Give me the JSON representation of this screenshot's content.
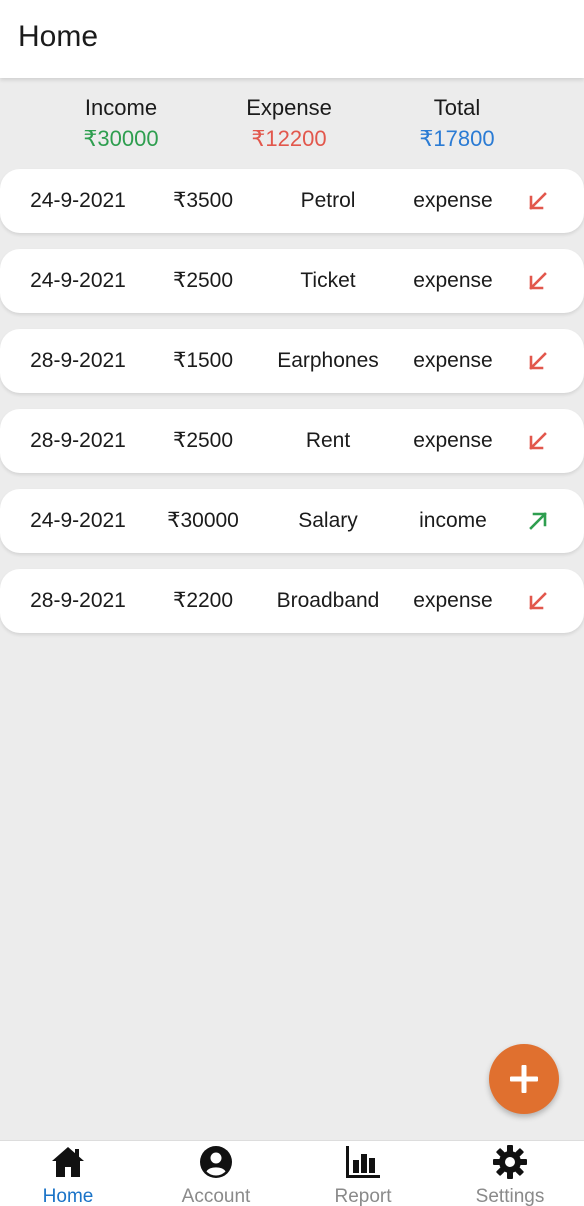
{
  "app_bar": {
    "title": "Home"
  },
  "summary": {
    "income": {
      "label": "Income",
      "value": "₹30000"
    },
    "expense": {
      "label": "Expense",
      "value": "₹12200"
    },
    "total": {
      "label": "Total",
      "value": "₹17800"
    }
  },
  "transactions": [
    {
      "date": "24-9-2021",
      "amount": "₹3500",
      "title": "Petrol",
      "type": "expense",
      "icon": "arrow-down-left-icon"
    },
    {
      "date": "24-9-2021",
      "amount": "₹2500",
      "title": "Ticket",
      "type": "expense",
      "icon": "arrow-down-left-icon"
    },
    {
      "date": "28-9-2021",
      "amount": "₹1500",
      "title": "Earphones",
      "type": "expense",
      "icon": "arrow-down-left-icon"
    },
    {
      "date": "28-9-2021",
      "amount": "₹2500",
      "title": "Rent",
      "type": "expense",
      "icon": "arrow-down-left-icon"
    },
    {
      "date": "24-9-2021",
      "amount": "₹30000",
      "title": "Salary",
      "type": "income",
      "icon": "arrow-up-right-icon"
    },
    {
      "date": "28-9-2021",
      "amount": "₹2200",
      "title": "Broadband",
      "type": "expense",
      "icon": "arrow-down-left-icon"
    }
  ],
  "fab": {
    "icon": "plus-icon"
  },
  "bottom_nav": {
    "items": [
      {
        "label": "Home",
        "icon": "home-icon",
        "active": true
      },
      {
        "label": "Account",
        "icon": "account-circle-icon",
        "active": false
      },
      {
        "label": "Report",
        "icon": "bar-chart-icon",
        "active": false
      },
      {
        "label": "Settings",
        "icon": "gear-icon",
        "active": false
      }
    ]
  },
  "colors": {
    "income": "#2e9e4f",
    "expense": "#e2574c",
    "total": "#2a7bd4",
    "fab": "#e0702f",
    "nav_active": "#1a73c7",
    "nav_inactive": "#8a8a8a"
  }
}
